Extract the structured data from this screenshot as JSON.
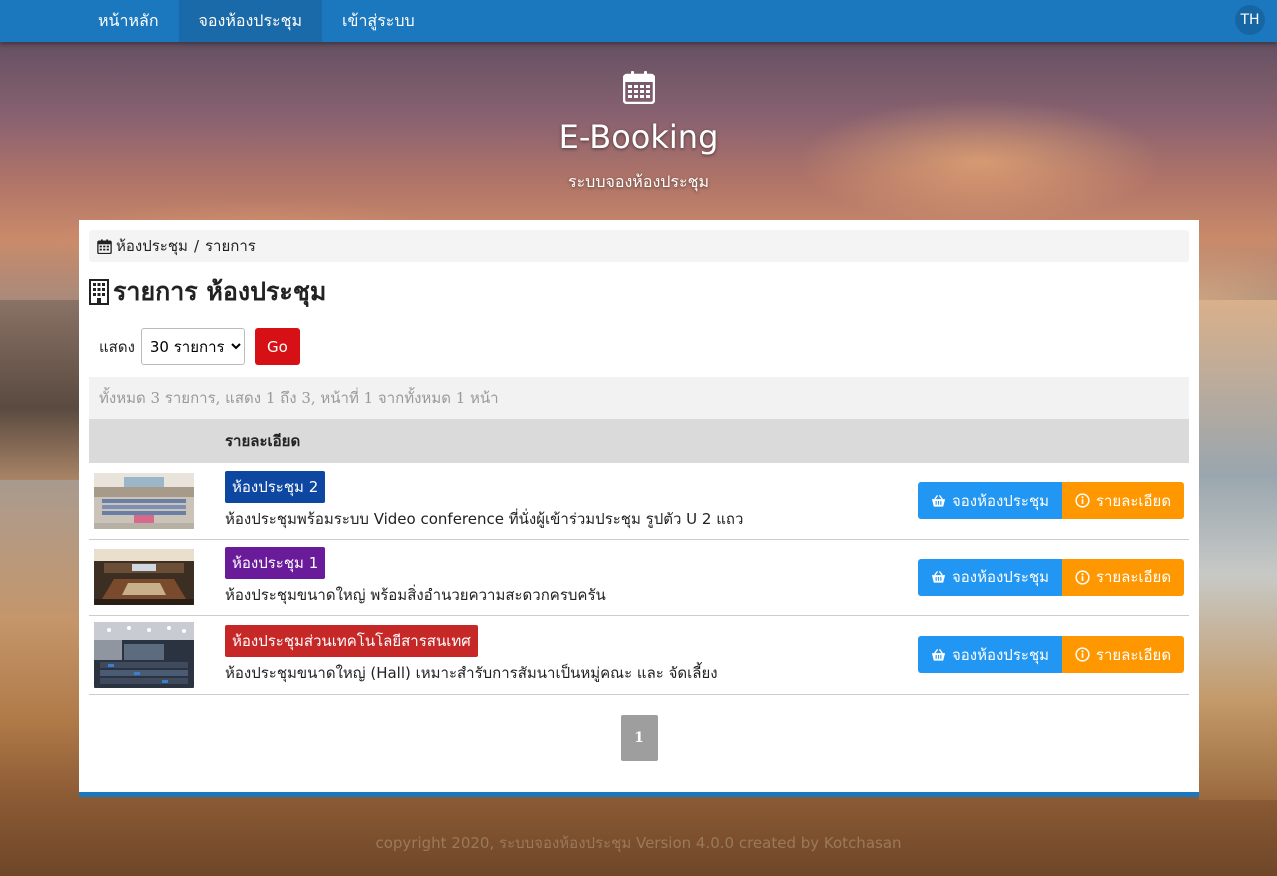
{
  "nav": {
    "items": [
      {
        "label": "หน้าหลัก",
        "active": false
      },
      {
        "label": "จองห้องประชุม",
        "active": true
      },
      {
        "label": "เข้าสู่ระบบ",
        "active": false
      }
    ],
    "language": "TH"
  },
  "hero": {
    "icon": "calendar-icon",
    "title": "E-Booking",
    "subtitle": "ระบบจองห้องประชุม"
  },
  "breadcrumb": {
    "icon": "calendar-icon",
    "items": [
      "ห้องประชุม",
      "รายการ"
    ],
    "separator": "/"
  },
  "page": {
    "icon": "building-icon",
    "title": "รายการ ห้องประชุม"
  },
  "filter": {
    "label": "แสดง",
    "selected": "30 รายการ",
    "go_label": "Go"
  },
  "summary": "ทั้งหมด 3 รายการ, แสดง 1 ถึง 3, หน้าที่ 1 จากทั้งหมด 1 หน้า",
  "table": {
    "header_detail": "รายละเอียด",
    "rows": [
      {
        "name": "ห้องประชุม 2",
        "color": "#0d47a1",
        "description": "ห้องประชุมพร้อมระบบ Video conference ที่นั่งผู้เข้าร่วมประชุม รูปตัว U 2 แถว",
        "book_label": "จองห้องประชุม",
        "detail_label": "รายละเอียด"
      },
      {
        "name": "ห้องประชุม 1",
        "color": "#6a1b9a",
        "description": "ห้องประชุมขนาดใหญ่ พร้อมสิ่งอำนวยความสะดวกครบครัน",
        "book_label": "จองห้องประชุม",
        "detail_label": "รายละเอียด"
      },
      {
        "name": "ห้องประชุมส่วนเทคโนโลยีสารสนเทศ",
        "color": "#c62828",
        "description": "ห้องประชุมขนาดใหญ่ (Hall) เหมาะสำรับการสัมนาเป็นหมู่คณะ และ จัดเลี้ยง",
        "book_label": "จองห้องประชุม",
        "detail_label": "รายละเอียด"
      }
    ]
  },
  "pagination": {
    "current": "1"
  },
  "footer": "copyright 2020, ระบบจองห้องประชุม Version 4.0.0 created by Kotchasan",
  "colors": {
    "nav": "#1b78bf",
    "book_button": "#2196f3",
    "detail_button": "#ff9800",
    "go_button": "#d71016"
  }
}
